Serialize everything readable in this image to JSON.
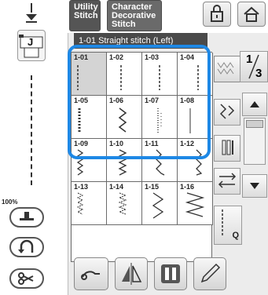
{
  "tabs": {
    "utility": [
      "Utility",
      "Stitch"
    ],
    "character": [
      "Character",
      "Decorative",
      "Stitch"
    ]
  },
  "title": "1-01 Straight stitch (Left)",
  "zoom": "100%",
  "page": {
    "current": "1",
    "total": "3"
  },
  "foot_label": "J",
  "q_label": "Q",
  "stitches": [
    "1-01",
    "1-02",
    "1-03",
    "1-04",
    "1-05",
    "1-06",
    "1-07",
    "1-08",
    "1-09",
    "1-10",
    "1-11",
    "1-12",
    "1-13",
    "1-14",
    "1-15",
    "1-16"
  ],
  "colors": {
    "highlight": "#1e88e5",
    "tab": "#555555",
    "selected_cell": "#d4d4d4"
  }
}
